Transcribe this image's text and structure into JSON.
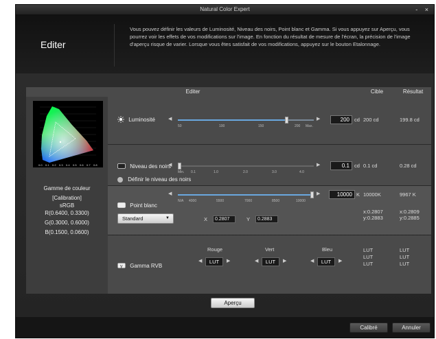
{
  "window": {
    "title": "Natural Color Expert",
    "controls": [
      "-",
      "×"
    ]
  },
  "header": {
    "title": "Editer",
    "description": "Vous pouvez définir les valeurs de Luminosité, Niveau des noirs, Point blanc et Gamma. Si vous appuyez sur Aperçu, vous pourrez voir les effets de vos modifications sur l'image. En fonction du résultat de mesure de l'écran, la précision de l'image d'aperçu risque de varier. Lorsque vous êtes satisfait de vos modifications, appuyez sur le bouton Etalonnage."
  },
  "columns": {
    "edit": "Editer",
    "target": "Cible",
    "result": "Résultat"
  },
  "gamut": {
    "axis_ticks": [
      "0.0",
      "0.1",
      "0.2",
      "0.3",
      "0.4",
      "0.5",
      "0.6",
      "0.7",
      "0.8"
    ],
    "title": "Gamme de couleur",
    "mode": "[Calibration]",
    "space": "sRGB",
    "r": "R(0.6400, 0.3300)",
    "g": "G(0.3000, 0.6000)",
    "b": "B(0.1500, 0.0600)"
  },
  "brightness": {
    "label": "Luminosité",
    "value": "200",
    "unit": "cd",
    "ticks": [
      "50",
      "100",
      "150",
      "200",
      "Max."
    ],
    "level": 0.8,
    "target": "200 cd",
    "result": "199.8 cd"
  },
  "black": {
    "label": "Niveau des noirs",
    "value": "0.1",
    "unit": "cd",
    "ticks": [
      "Min.",
      "0.1",
      "1.0",
      "2.0",
      "3.0",
      "4.0"
    ],
    "level": 0.0,
    "target": "0.1 cd",
    "result": "0.28 cd",
    "option": "Définir le niveau des noirs"
  },
  "white": {
    "label": "Point blanc",
    "value": "10000",
    "unit": "K",
    "ticks": [
      "N/A",
      "4000",
      "5500",
      "7000",
      "8500",
      "10000"
    ],
    "level": 1.0,
    "preset": "Standard",
    "x_label": "X",
    "x_value": "0.2807",
    "y_label": "Y",
    "y_value": "0.2883",
    "target": "10000K",
    "target_x": "x:0.2807",
    "target_y": "y:0.2883",
    "result": "9967 K",
    "result_x": "x:0.2809",
    "result_y": "y:0.2885"
  },
  "gamma": {
    "label": "Gamma RVB",
    "channels": [
      {
        "name": "Rouge",
        "value": "LUT"
      },
      {
        "name": "Vert",
        "value": "LUT"
      },
      {
        "name": "Bleu",
        "value": "LUT"
      }
    ],
    "target": [
      "LUT",
      "LUT",
      "LUT"
    ],
    "result": [
      "LUT",
      "LUT",
      "LUT"
    ]
  },
  "buttons": {
    "preview": "Aperçu",
    "calibrate": "Calibré",
    "cancel": "Annuler"
  },
  "colors": {
    "accent": "#6aa8e0",
    "panel": "#4a4a4a",
    "background": "#1b1b1b"
  }
}
